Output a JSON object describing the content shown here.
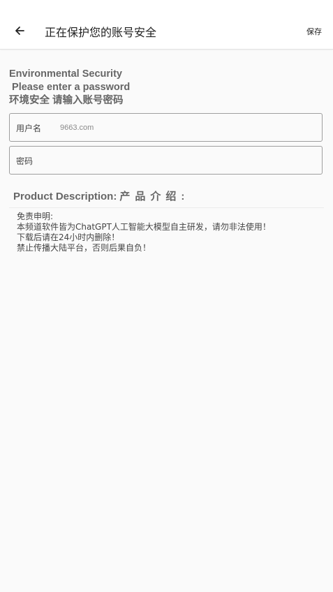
{
  "toolbar": {
    "back_icon": "arrow-left-icon",
    "title": "正在保护您的账号安全",
    "save_label": "保存"
  },
  "heading": {
    "line1": "Environmental Security",
    "line2": " Please enter a password",
    "line3": "环境安全 请输入账号密码"
  },
  "form": {
    "username": {
      "label": "用户名",
      "placeholder": "9663.com",
      "value": ""
    },
    "password": {
      "label": "密码",
      "placeholder": "",
      "value": ""
    }
  },
  "description": {
    "heading_en": "Product Description:",
    "heading_cn": "产品介绍:",
    "lines": [
      "免责申明:",
      "本频道软件皆为ChatGPT人工智能大模型自主研发，请勿非法使用！",
      "下载后请在24小时内删除！",
      "禁止传播大陆平台，否则后果自负！"
    ]
  },
  "colors": {
    "background": "#fafafa",
    "toolbar": "#ffffff",
    "heading_text": "#666666",
    "field_border": "#9e9e9e"
  }
}
